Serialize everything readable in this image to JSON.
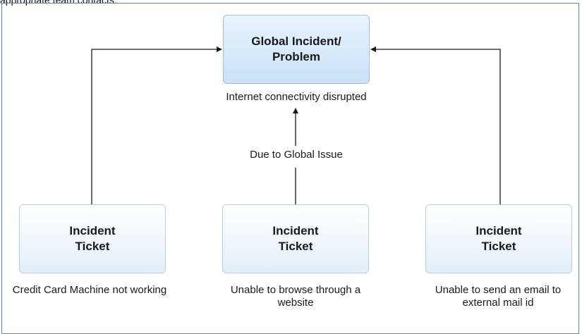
{
  "top_caption": "appropriate team contacts.",
  "global_box": {
    "title": "Global Incident/\nProblem",
    "description": "Internet connectivity disrupted"
  },
  "connector_label": "Due to Global Issue",
  "tickets": [
    {
      "title": "Incident\nTicket",
      "caption": "Credit Card Machine not working"
    },
    {
      "title": "Incident\nTicket",
      "caption": "Unable to browse through a website"
    },
    {
      "title": "Incident\nTicket",
      "caption_line1": "Unable to send an email to",
      "caption_line2": "external mail id"
    }
  ],
  "colors": {
    "frame_border": "#5e86b8",
    "global_box_fill": "#c8e1f6",
    "ticket_box_fill": "#e4edf6",
    "arrow": "#1a1a1a"
  }
}
